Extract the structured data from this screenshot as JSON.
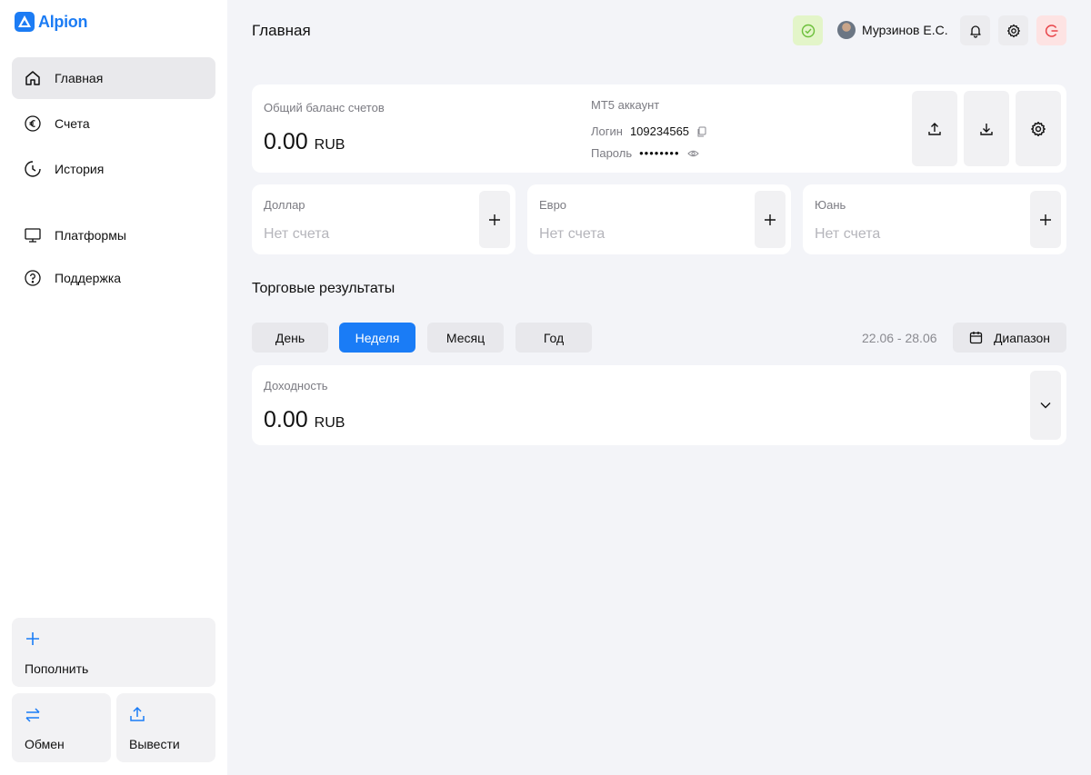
{
  "brand": {
    "name": "Alpion",
    "color": "#1c7cf4"
  },
  "sidebar": {
    "items": [
      {
        "label": "Главная",
        "icon": "home-icon",
        "active": true
      },
      {
        "label": "Счета",
        "icon": "euro-icon"
      },
      {
        "label": "История",
        "icon": "clock-icon"
      },
      {
        "label": "Платформы",
        "icon": "monitor-icon"
      },
      {
        "label": "Поддержка",
        "icon": "help-icon"
      }
    ],
    "actions": {
      "deposit": "Пополнить",
      "exchange": "Обмен",
      "withdraw": "Вывести"
    }
  },
  "header": {
    "title": "Главная",
    "user_name": "Мурзинов Е.С."
  },
  "balance": {
    "label": "Общий баланс счетов",
    "amount": "0.00",
    "currency": "RUB"
  },
  "mt5": {
    "title": "MT5 аккаунт",
    "login_label": "Логин",
    "login_value": "109234565",
    "password_label": "Пароль",
    "password_value": "••••••••"
  },
  "currencies": [
    {
      "name": "Доллар",
      "status": "Нет счета"
    },
    {
      "name": "Евро",
      "status": "Нет счета"
    },
    {
      "name": "Юань",
      "status": "Нет счета"
    }
  ],
  "trading": {
    "title": "Торговые результаты",
    "periods": [
      "День",
      "Неделя",
      "Месяц",
      "Год"
    ],
    "active_period": "Неделя",
    "date_range": "22.06 - 28.06",
    "range_button": "Диапазон",
    "yield_label": "Доходность",
    "yield_amount": "0.00",
    "yield_currency": "RUB"
  },
  "colors": {
    "accent": "#1a7cf6",
    "status_ok_bg": "#e3f5c9",
    "status_ok": "#6bbf3a",
    "logout_bg": "#fde3e3",
    "logout": "#e8454a"
  }
}
